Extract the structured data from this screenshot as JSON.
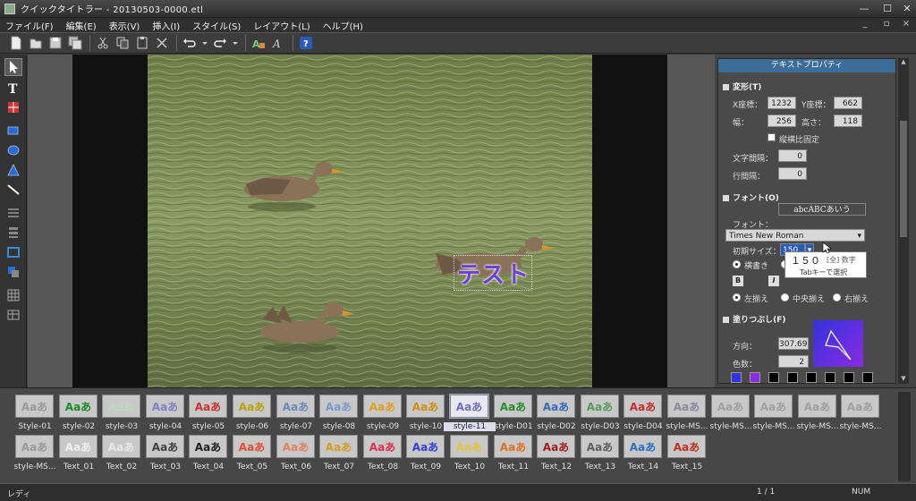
{
  "window": {
    "title": "クイックタイトラー - 20130503-0000.etl",
    "controls": [
      "minimize",
      "maximize",
      "close"
    ]
  },
  "menu": [
    "ファイル(F)",
    "編集(E)",
    "表示(V)",
    "挿入(I)",
    "スタイル(S)",
    "レイアウト(L)",
    "ヘルプ(H)"
  ],
  "toolbar_icons": [
    "new-file-icon",
    "open-icon",
    "save-icon",
    "save-all-icon",
    "cut-icon",
    "copy-icon",
    "paste-icon",
    "delete-icon",
    "undo-icon",
    "redo-icon",
    "text-style-icon",
    "font-icon",
    "help-icon"
  ],
  "canvas": {
    "overlay_text": "テスト",
    "overlay_color": "#6a40d8"
  },
  "properties": {
    "title": "テキストプロパティ",
    "transform": {
      "header": "変形(T)",
      "x_label": "X座標：",
      "x_value": "1232",
      "y_label": "Y座標：",
      "y_value": "662",
      "w_label": "幅：",
      "w_value": "256",
      "h_label": "高さ：",
      "h_value": "118",
      "lock_label": "縦横比固定",
      "char_spacing_label": "文字間隔：",
      "char_spacing_value": "0",
      "line_spacing_label": "行間隔：",
      "line_spacing_value": "0"
    },
    "font": {
      "header": "フォント(O)",
      "preview": "abcABCあいう",
      "font_label": "フォント：",
      "font_value": "Times New Roman",
      "size_label": "初期サイズ：",
      "size_value": "150",
      "horizontal_label": "横書き",
      "bold": "B",
      "italic": "I",
      "align_left": "左揃え",
      "align_center": "中央揃え",
      "align_right": "右揃え"
    },
    "fill": {
      "header": "塗りつぶし(F)",
      "direction_label": "方向：",
      "direction_value": "307.69",
      "colors_label": "色数：",
      "colors_value": "2",
      "swatches": [
        "#3333dd",
        "#8a2be2",
        "#000000",
        "#000000",
        "#000000",
        "#000000",
        "#000000",
        "#000000"
      ]
    }
  },
  "ime_popup": {
    "candidate": "１５０",
    "mode": "[全] 数字",
    "hint": "Tabキーで選択"
  },
  "styles_row1": [
    {
      "label": "Style-01",
      "text": "Aaあ",
      "color": "#9a9a9a"
    },
    {
      "label": "style-02",
      "text": "Aaあ",
      "color": "#1a8a2a"
    },
    {
      "label": "style-03",
      "text": "Aaあ",
      "color": "#c0d8c0"
    },
    {
      "label": "style-04",
      "text": "Aaあ",
      "color": "#8080c8"
    },
    {
      "label": "style-05",
      "text": "Aaあ",
      "color": "#d03030"
    },
    {
      "label": "style-06",
      "text": "Aaあ",
      "color": "#b8a010"
    },
    {
      "label": "style-07",
      "text": "Aaあ",
      "color": "#6a8ab8"
    },
    {
      "label": "style-08",
      "text": "Aaあ",
      "color": "#7a9acc"
    },
    {
      "label": "style-09",
      "text": "Aaあ",
      "color": "#e0a020"
    },
    {
      "label": "style-10",
      "text": "Aaあ",
      "color": "#d09010"
    },
    {
      "label": "style-11",
      "text": "Aaあ",
      "color": "#7070c0"
    },
    {
      "label": "style-D01",
      "text": "Aaあ",
      "color": "#2a8a2a"
    },
    {
      "label": "style-D02",
      "text": "Aaあ",
      "color": "#3a6ab8"
    },
    {
      "label": "style-D03",
      "text": "Aaあ",
      "color": "#5a9a5a"
    },
    {
      "label": "style-D04",
      "text": "Aaあ",
      "color": "#c83030"
    },
    {
      "label": "style-MS...",
      "text": "Aaあ",
      "color": "#8a8a9a"
    },
    {
      "label": "style-MS...",
      "text": "Aaあ",
      "color": "#a0a0a0"
    },
    {
      "label": "style-MS...",
      "text": "Aaあ",
      "color": "#a0a0a0"
    },
    {
      "label": "style-MS...",
      "text": "Aaあ",
      "color": "#a0a0a0"
    },
    {
      "label": "style-MS...",
      "text": "Aaあ",
      "color": "#a0a0a0"
    }
  ],
  "styles_row2": [
    {
      "label": "style-MS...",
      "text": "Aaあ",
      "color": "#9a9a9a"
    },
    {
      "label": "Text_01",
      "text": "Aaあ",
      "color": "#f0f0f0"
    },
    {
      "label": "Text_02",
      "text": "Aaあ",
      "color": "#e8e8e8"
    },
    {
      "label": "Text_03",
      "text": "Aaあ",
      "color": "#404040"
    },
    {
      "label": "Text_04",
      "text": "Aaあ",
      "color": "#202020"
    },
    {
      "label": "Text_05",
      "text": "Aaあ",
      "color": "#e05030"
    },
    {
      "label": "Text_06",
      "text": "Aaあ",
      "color": "#e08060"
    },
    {
      "label": "Text_07",
      "text": "Aaあ",
      "color": "#d0a020"
    },
    {
      "label": "Text_08",
      "text": "Aaあ",
      "color": "#e03050"
    },
    {
      "label": "Text_09",
      "text": "Aaあ",
      "color": "#3040d0"
    },
    {
      "label": "Text_10",
      "text": "Aaあ",
      "color": "#e8c040"
    },
    {
      "label": "Text_11",
      "text": "Aaあ",
      "color": "#e07020"
    },
    {
      "label": "Text_12",
      "text": "Aaあ",
      "color": "#a02020"
    },
    {
      "label": "Text_13",
      "text": "Aaあ",
      "color": "#606060"
    },
    {
      "label": "Text_14",
      "text": "Aaあ",
      "color": "#3070c0"
    },
    {
      "label": "Text_15",
      "text": "Aaあ",
      "color": "#c03020"
    }
  ],
  "selected_style": "style-11",
  "status": {
    "left": "レディ",
    "page": "1 / 1",
    "num": "NUM"
  }
}
